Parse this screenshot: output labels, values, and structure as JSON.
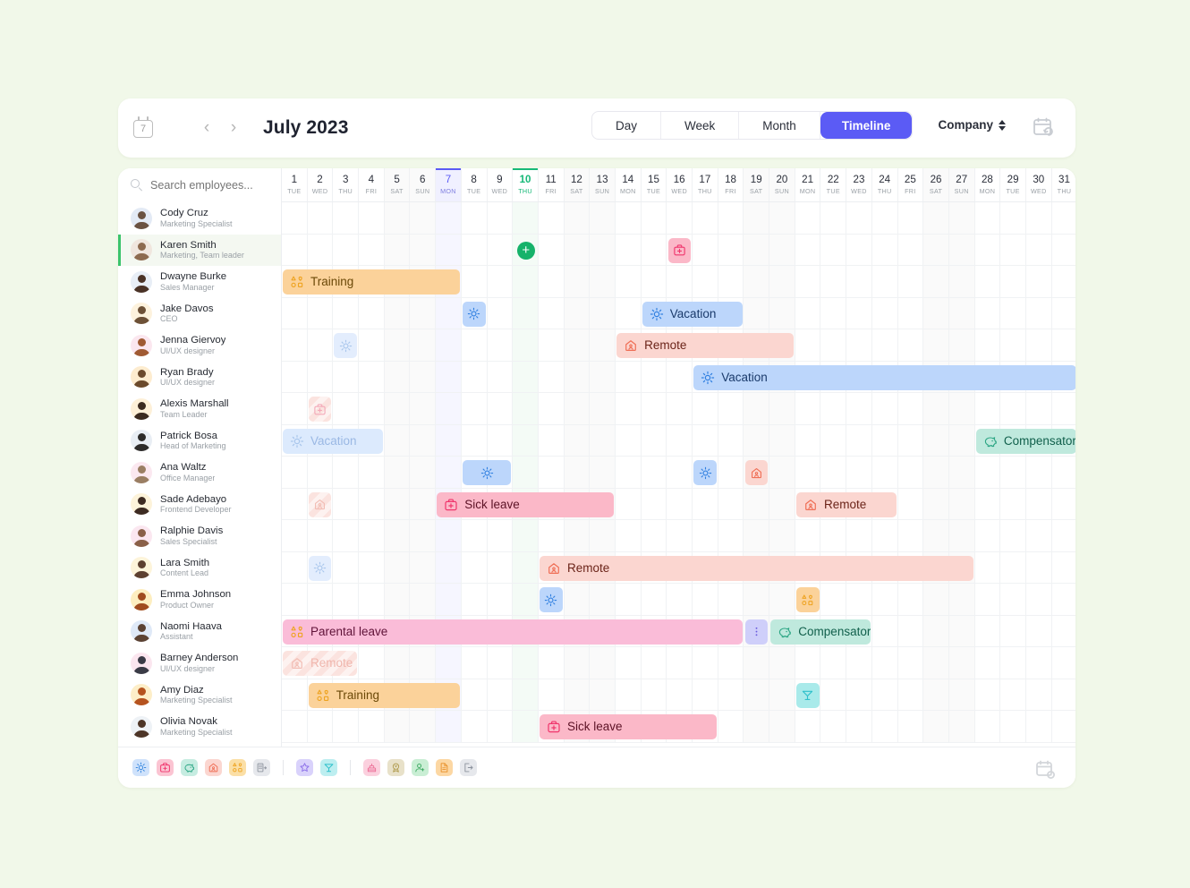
{
  "topbar": {
    "calendar_icon_day": "7",
    "prev_label": "‹",
    "next_label": "›",
    "month_title": "July 2023",
    "views": [
      {
        "label": "Day",
        "active": false
      },
      {
        "label": "Week",
        "active": false
      },
      {
        "label": "Month",
        "active": false
      },
      {
        "label": "Timeline",
        "active": true
      }
    ],
    "scope_label": "Company",
    "accent_color": "#5B5BF5"
  },
  "search": {
    "placeholder": "Search employees..."
  },
  "employees": [
    {
      "name": "Cody Cruz",
      "role": "Marketing Specialist",
      "selected": false,
      "av_bg": "#e3eaf5",
      "av_fg": "#6a5242"
    },
    {
      "name": "Karen Smith",
      "role": "Marketing, Team leader",
      "selected": true,
      "av_bg": "#f0e6de",
      "av_fg": "#8d6a4f"
    },
    {
      "name": "Dwayne Burke",
      "role": "Sales Manager",
      "selected": false,
      "av_bg": "#e8eef6",
      "av_fg": "#4a3226"
    },
    {
      "name": "Jake Davos",
      "role": "CEO",
      "selected": false,
      "av_bg": "#fdf2dd",
      "av_fg": "#6d5137"
    },
    {
      "name": "Jenna Giervoy",
      "role": "UI/UX designer",
      "selected": false,
      "av_bg": "#fbe7ef",
      "av_fg": "#a05a33"
    },
    {
      "name": "Ryan Brady",
      "role": "UI/UX designer",
      "selected": false,
      "av_bg": "#fdeccf",
      "av_fg": "#6b4a2c"
    },
    {
      "name": "Alexis Marshall",
      "role": "Team Leader",
      "selected": false,
      "av_bg": "#fdf0d8",
      "av_fg": "#3b2b20"
    },
    {
      "name": "Patrick Bosa",
      "role": "Head of Marketing",
      "selected": false,
      "av_bg": "#e9eef4",
      "av_fg": "#2d2b2a"
    },
    {
      "name": "Ana Waltz",
      "role": "Office Manager",
      "selected": false,
      "av_bg": "#fbe8f0",
      "av_fg": "#9a7e63"
    },
    {
      "name": "Sade Adebayo",
      "role": "Frontend Developer",
      "selected": false,
      "av_bg": "#fdf3da",
      "av_fg": "#3d2b22"
    },
    {
      "name": "Ralphie Davis",
      "role": "Sales Specialist",
      "selected": false,
      "av_bg": "#fbe7f0",
      "av_fg": "#8a6048"
    },
    {
      "name": "Lara Smith",
      "role": "Content Lead",
      "selected": false,
      "av_bg": "#fdf4da",
      "av_fg": "#5d4030"
    },
    {
      "name": "Emma Johnson",
      "role": "Product Owner",
      "selected": false,
      "av_bg": "#fdeec0",
      "av_fg": "#a04b1e"
    },
    {
      "name": "Naomi Haava",
      "role": "Assistant",
      "selected": false,
      "av_bg": "#dfe9f7",
      "av_fg": "#5b4233"
    },
    {
      "name": "Barney Anderson",
      "role": "UI/UX designer",
      "selected": false,
      "av_bg": "#fbe6ef",
      "av_fg": "#3a3b46"
    },
    {
      "name": "Amy Diaz",
      "role": "Marketing Specialist",
      "selected": false,
      "av_bg": "#fdeec8",
      "av_fg": "#b5531f"
    },
    {
      "name": "Olivia Novak",
      "role": "Marketing Specialist",
      "selected": false,
      "av_bg": "#eef2f6",
      "av_fg": "#4d3527"
    }
  ],
  "days": [
    {
      "num": "1",
      "wd": "TUE",
      "weekend": false,
      "state": ""
    },
    {
      "num": "2",
      "wd": "WED",
      "weekend": false,
      "state": ""
    },
    {
      "num": "3",
      "wd": "THU",
      "weekend": false,
      "state": ""
    },
    {
      "num": "4",
      "wd": "FRI",
      "weekend": false,
      "state": ""
    },
    {
      "num": "5",
      "wd": "SAT",
      "weekend": true,
      "state": ""
    },
    {
      "num": "6",
      "wd": "SUN",
      "weekend": true,
      "state": ""
    },
    {
      "num": "7",
      "wd": "MON",
      "weekend": false,
      "state": "sel"
    },
    {
      "num": "8",
      "wd": "TUE",
      "weekend": false,
      "state": ""
    },
    {
      "num": "9",
      "wd": "WED",
      "weekend": false,
      "state": ""
    },
    {
      "num": "10",
      "wd": "THU",
      "weekend": false,
      "state": "today"
    },
    {
      "num": "11",
      "wd": "FRI",
      "weekend": false,
      "state": ""
    },
    {
      "num": "12",
      "wd": "SAT",
      "weekend": true,
      "state": ""
    },
    {
      "num": "13",
      "wd": "SUN",
      "weekend": true,
      "state": ""
    },
    {
      "num": "14",
      "wd": "MON",
      "weekend": false,
      "state": ""
    },
    {
      "num": "15",
      "wd": "TUE",
      "weekend": false,
      "state": ""
    },
    {
      "num": "16",
      "wd": "WED",
      "weekend": false,
      "state": ""
    },
    {
      "num": "17",
      "wd": "THU",
      "weekend": false,
      "state": ""
    },
    {
      "num": "18",
      "wd": "FRI",
      "weekend": false,
      "state": ""
    },
    {
      "num": "19",
      "wd": "SAT",
      "weekend": true,
      "state": ""
    },
    {
      "num": "20",
      "wd": "SUN",
      "weekend": true,
      "state": ""
    },
    {
      "num": "21",
      "wd": "MON",
      "weekend": false,
      "state": ""
    },
    {
      "num": "22",
      "wd": "TUE",
      "weekend": false,
      "state": ""
    },
    {
      "num": "23",
      "wd": "WED",
      "weekend": false,
      "state": ""
    },
    {
      "num": "24",
      "wd": "THU",
      "weekend": false,
      "state": ""
    },
    {
      "num": "25",
      "wd": "FRI",
      "weekend": false,
      "state": ""
    },
    {
      "num": "26",
      "wd": "SAT",
      "weekend": true,
      "state": ""
    },
    {
      "num": "27",
      "wd": "SUN",
      "weekend": true,
      "state": ""
    },
    {
      "num": "28",
      "wd": "MON",
      "weekend": false,
      "state": ""
    },
    {
      "num": "29",
      "wd": "TUE",
      "weekend": false,
      "state": ""
    },
    {
      "num": "30",
      "wd": "WED",
      "weekend": false,
      "state": ""
    },
    {
      "num": "31",
      "wd": "THU",
      "weekend": false,
      "state": ""
    }
  ],
  "events": [
    {
      "row": 1,
      "start": 10,
      "span": 1,
      "label": "",
      "icon": "plus-circle",
      "kind": "add"
    },
    {
      "row": 1,
      "start": 16,
      "span": 1,
      "label": "",
      "icon": "first-aid",
      "kind": "sickchip"
    },
    {
      "row": 2,
      "start": 1,
      "span": 7,
      "label": "Training",
      "icon": "shapes",
      "kind": "training"
    },
    {
      "row": 3,
      "start": 8,
      "span": 1,
      "label": "",
      "icon": "sun",
      "kind": "sunchip"
    },
    {
      "row": 3,
      "start": 15,
      "span": 4,
      "label": "Vacation",
      "icon": "sun",
      "kind": "vacation"
    },
    {
      "row": 4,
      "start": 3,
      "span": 1,
      "label": "",
      "icon": "sun",
      "kind": "sunchip-faint"
    },
    {
      "row": 4,
      "start": 14,
      "span": 7,
      "label": "Remote",
      "icon": "home",
      "kind": "remote"
    },
    {
      "row": 5,
      "start": 17,
      "span": 15,
      "label": "Vacation",
      "icon": "sun",
      "kind": "vacation"
    },
    {
      "row": 6,
      "start": 2,
      "span": 1,
      "label": "",
      "icon": "first-aid",
      "kind": "sickchip-faded"
    },
    {
      "row": 7,
      "start": 1,
      "span": 4,
      "label": "Vacation",
      "icon": "sun",
      "kind": "vacation-faded"
    },
    {
      "row": 7,
      "start": 28,
      "span": 4,
      "label": "Compensatory",
      "icon": "piggy",
      "kind": "comp"
    },
    {
      "row": 8,
      "start": 8,
      "span": 2,
      "label": "",
      "icon": "sun",
      "kind": "sunchip"
    },
    {
      "row": 8,
      "start": 17,
      "span": 1,
      "label": "",
      "icon": "sun",
      "kind": "sunchip"
    },
    {
      "row": 8,
      "start": 19,
      "span": 1,
      "label": "",
      "icon": "home",
      "kind": "homechip"
    },
    {
      "row": 9,
      "start": 2,
      "span": 1,
      "label": "",
      "icon": "home",
      "kind": "homechip-faded"
    },
    {
      "row": 9,
      "start": 7,
      "span": 7,
      "label": "Sick leave",
      "icon": "first-aid",
      "kind": "sick"
    },
    {
      "row": 9,
      "start": 21,
      "span": 4,
      "label": "Remote",
      "icon": "home",
      "kind": "remote"
    },
    {
      "row": 11,
      "start": 2,
      "span": 1,
      "label": "",
      "icon": "sun",
      "kind": "sunchip-faint"
    },
    {
      "row": 11,
      "start": 11,
      "span": 17,
      "label": "Remote",
      "icon": "home",
      "kind": "remote-striped"
    },
    {
      "row": 12,
      "start": 11,
      "span": 1,
      "label": "",
      "icon": "sun",
      "kind": "sunchip"
    },
    {
      "row": 12,
      "start": 21,
      "span": 1,
      "label": "",
      "icon": "shapes",
      "kind": "trainchip"
    },
    {
      "row": 13,
      "start": 1,
      "span": 18,
      "label": "Parental leave",
      "icon": "shapes",
      "kind": "parental"
    },
    {
      "row": 13,
      "start": 19,
      "span": 1,
      "label": "",
      "icon": "dots",
      "kind": "purplechip"
    },
    {
      "row": 13,
      "start": 20,
      "span": 4,
      "label": "Compensatory",
      "icon": "piggy",
      "kind": "comp-dotted"
    },
    {
      "row": 14,
      "start": 1,
      "span": 3,
      "label": "Remote",
      "icon": "home",
      "kind": "remote-striped-faded"
    },
    {
      "row": 15,
      "start": 2,
      "span": 6,
      "label": "Training",
      "icon": "shapes",
      "kind": "training"
    },
    {
      "row": 15,
      "start": 21,
      "span": 1,
      "label": "",
      "icon": "cocktail",
      "kind": "cocktailchip"
    },
    {
      "row": 16,
      "start": 11,
      "span": 7,
      "label": "Sick leave",
      "icon": "first-aid",
      "kind": "sick"
    }
  ],
  "legend": [
    {
      "icon": "sun",
      "name": "vacation",
      "bg": "#cfe2fb",
      "fg": "#3b8ae0"
    },
    {
      "icon": "first-aid",
      "name": "sick-leave",
      "bg": "#fbc4d2",
      "fg": "#f0356c"
    },
    {
      "icon": "piggy",
      "name": "compensatory",
      "bg": "#c6ece1",
      "fg": "#2aa583"
    },
    {
      "icon": "home",
      "name": "remote",
      "bg": "#fbd6d0",
      "fg": "#ef6f56"
    },
    {
      "icon": "shapes",
      "name": "training",
      "bg": "#fbdfa6",
      "fg": "#eea320"
    },
    {
      "icon": "building",
      "name": "business-trip",
      "bg": "#e6e8ec",
      "fg": "#8b919c"
    },
    {
      "icon": "star",
      "name": "birthday",
      "bg": "#d9d2fb",
      "fg": "#8a6de8"
    },
    {
      "icon": "cocktail",
      "name": "holiday",
      "bg": "#bdeef0",
      "fg": "#2fc0cb"
    },
    {
      "icon": "cake",
      "name": "anniversary",
      "bg": "#fbd0de",
      "fg": "#ec6d96"
    },
    {
      "icon": "ribbon",
      "name": "award",
      "bg": "#e8e1c9",
      "fg": "#b09b4e"
    },
    {
      "icon": "person-plus",
      "name": "onboarding",
      "bg": "#c9eed4",
      "fg": "#3aa85f"
    },
    {
      "icon": "document",
      "name": "probation",
      "bg": "#fcd7a3",
      "fg": "#e78f28"
    },
    {
      "icon": "exit",
      "name": "offboarding",
      "bg": "#e6e8ec",
      "fg": "#8b919c"
    }
  ]
}
